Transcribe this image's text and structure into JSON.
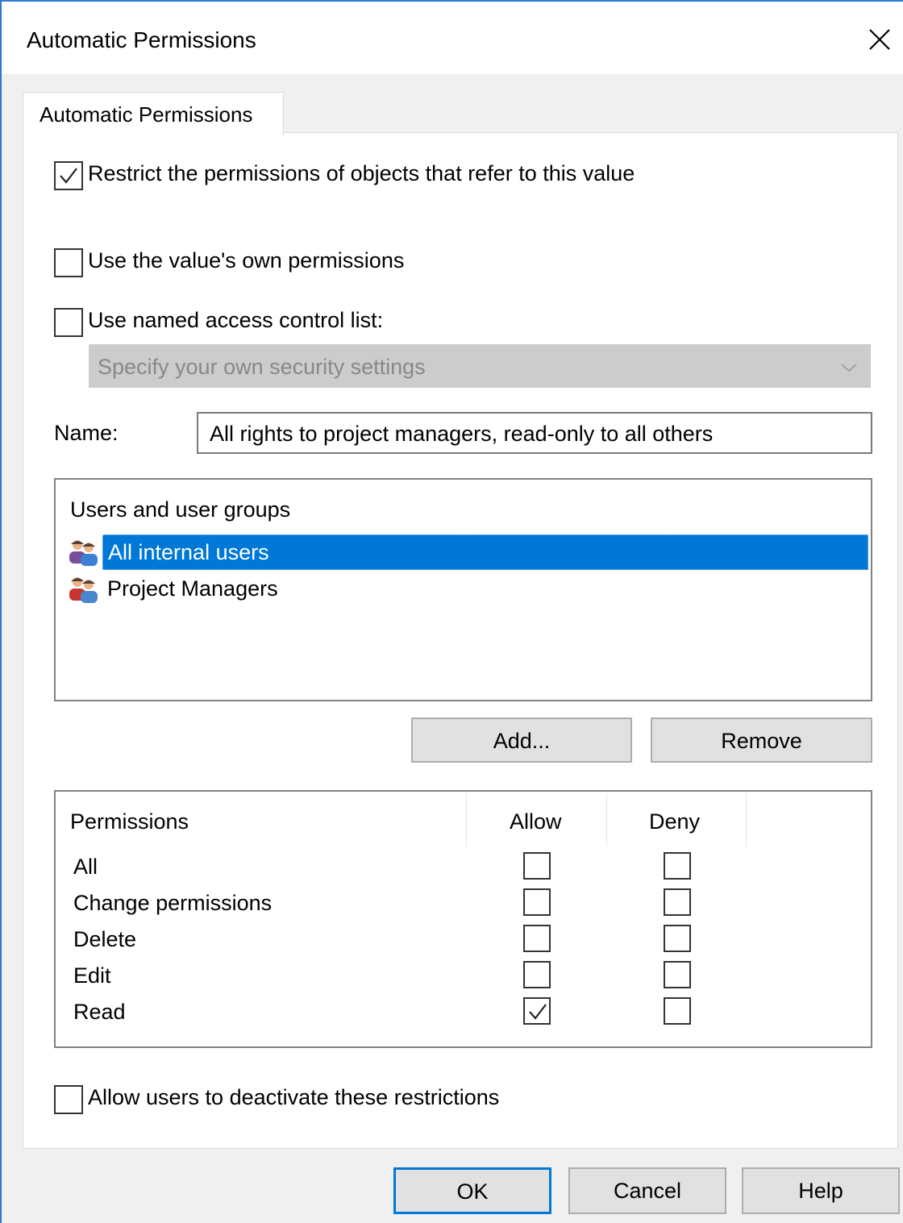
{
  "window": {
    "title": "Automatic Permissions"
  },
  "tab": {
    "label": "Automatic Permissions"
  },
  "options": {
    "restrict": {
      "label": "Restrict the permissions of objects that refer to this value",
      "checked": true
    },
    "own": {
      "label": "Use the value's own permissions",
      "checked": false
    },
    "named": {
      "label": "Use named access control list:",
      "checked": false
    },
    "dropdown": {
      "value": "Specify your own security settings",
      "enabled": false
    }
  },
  "name": {
    "label": "Name:",
    "value": "All rights to project managers, read-only to all others"
  },
  "users": {
    "header": "Users and user groups",
    "items": [
      {
        "label": "All internal users",
        "selected": true,
        "icon": "users-group-blue-icon"
      },
      {
        "label": "Project Managers",
        "selected": false,
        "icon": "users-group-red-icon"
      }
    ]
  },
  "user_buttons": {
    "add": "Add...",
    "remove": "Remove"
  },
  "permissions": {
    "header": "Permissions",
    "allow_header": "Allow",
    "deny_header": "Deny",
    "rows": [
      {
        "name": "All",
        "allow": false,
        "deny": false
      },
      {
        "name": "Change permissions",
        "allow": false,
        "deny": false
      },
      {
        "name": "Delete",
        "allow": false,
        "deny": false
      },
      {
        "name": "Edit",
        "allow": false,
        "deny": false
      },
      {
        "name": "Read",
        "allow": true,
        "deny": false
      }
    ]
  },
  "deactivate": {
    "label": "Allow users to deactivate these restrictions",
    "checked": false
  },
  "footer": {
    "ok": "OK",
    "cancel": "Cancel",
    "help": "Help"
  },
  "colors": {
    "accent": "#0078d7",
    "window_border": "#2b79d3",
    "selection": "#0078d7"
  }
}
